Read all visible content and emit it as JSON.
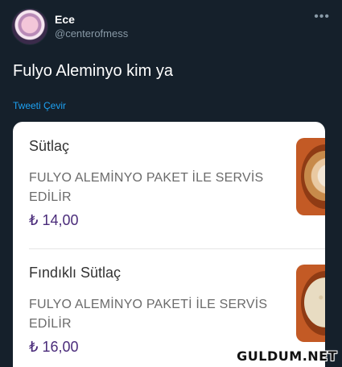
{
  "tweet": {
    "author_name": "Ece",
    "author_handle": "@centerofmess",
    "more_icon": "more-dots-icon",
    "text": "Fulyo Aleminyo kim ya",
    "translate_label": "Tweeti Çevir"
  },
  "menu": {
    "items": [
      {
        "title": "Sütlaç",
        "description": "FULYO ALEMİNYO PAKET İLE SERVİS EDİLİR",
        "price": "₺ 14,00"
      },
      {
        "title": "Fındıklı Sütlaç",
        "description": "FULYO ALEMİNYO  PAKETİ İLE SERVİS EDİLİR",
        "price": "₺ 16,00"
      }
    ]
  },
  "watermark": "GULDUM.NET",
  "colors": {
    "background": "#15202b",
    "link": "#1da1f2",
    "price": "#4a2b7a"
  }
}
